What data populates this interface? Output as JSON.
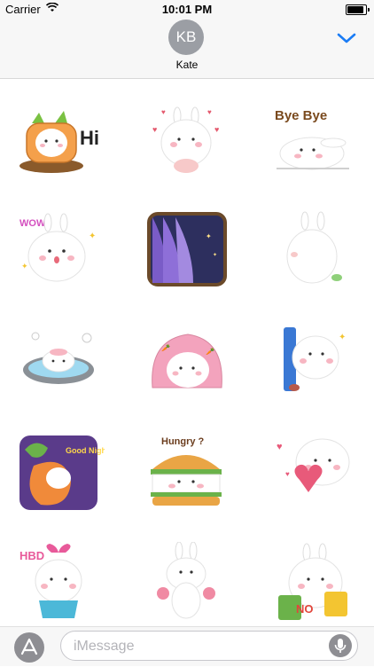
{
  "status_bar": {
    "carrier": "Carrier",
    "time": "10:01 PM",
    "battery_level": 0.9
  },
  "header": {
    "avatar_initials": "KB",
    "contact_name": "Kate",
    "avatar_color": "#9b9ea4",
    "accent_color": "#1a7cf5"
  },
  "stickers": [
    {
      "name": "carrot-bunny-hi",
      "caption": "Hi"
    },
    {
      "name": "bunny-hearts"
    },
    {
      "name": "bunny-bye-bye",
      "caption": "Bye Bye"
    },
    {
      "name": "bunny-wow",
      "caption": "WOW"
    },
    {
      "name": "night-window-curtain"
    },
    {
      "name": "bunny-back-view"
    },
    {
      "name": "bunny-hot-spring"
    },
    {
      "name": "bunny-sleeping-bag"
    },
    {
      "name": "bunny-peeking-door"
    },
    {
      "name": "bunny-carrot-good-night",
      "caption": "Good Night"
    },
    {
      "name": "bunny-burger",
      "caption": "Hungry ?"
    },
    {
      "name": "bunny-heart-gift"
    },
    {
      "name": "bunny-hbd-gift",
      "caption": "HBD"
    },
    {
      "name": "bunny-cheerleader"
    },
    {
      "name": "bunny-no-signs",
      "caption": "NO"
    }
  ],
  "input_bar": {
    "placeholder": "iMessage"
  }
}
